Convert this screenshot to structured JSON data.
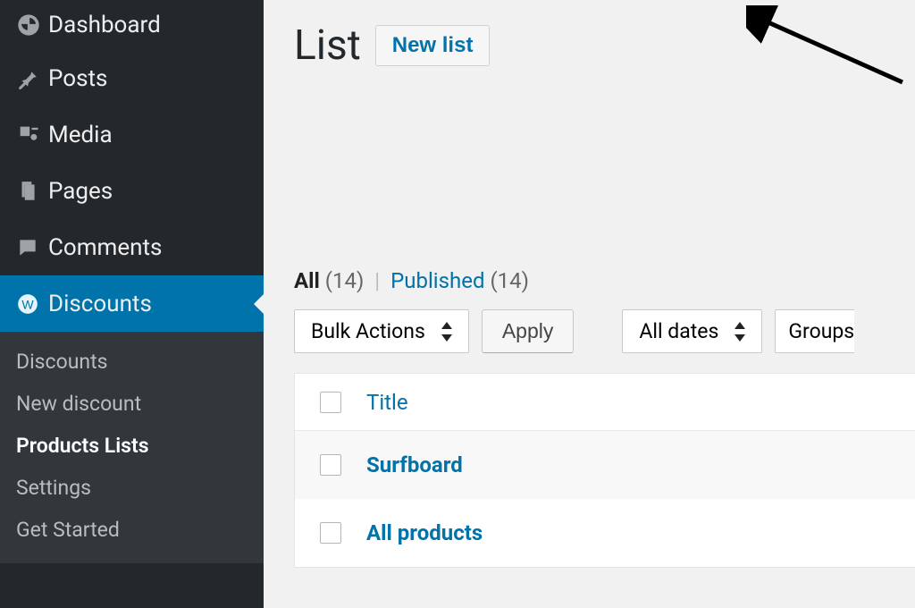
{
  "sidebar": {
    "items": [
      {
        "label": "Dashboard"
      },
      {
        "label": "Posts"
      },
      {
        "label": "Media"
      },
      {
        "label": "Pages"
      },
      {
        "label": "Comments"
      },
      {
        "label": "Discounts"
      }
    ],
    "submenu": {
      "items": [
        {
          "label": "Discounts"
        },
        {
          "label": "New discount"
        },
        {
          "label": "Products Lists"
        },
        {
          "label": "Settings"
        },
        {
          "label": "Get Started"
        }
      ]
    }
  },
  "header": {
    "title": "List",
    "new_list_label": "New list"
  },
  "filters": {
    "all_label": "All",
    "all_count": "(14)",
    "divider": "|",
    "published_label": "Published",
    "published_count": "(14)"
  },
  "controls": {
    "bulk_actions_label": "Bulk Actions",
    "apply_label": "Apply",
    "dates_label": "All dates",
    "groups_label": "Groups"
  },
  "table": {
    "th_title": "Title",
    "rows": [
      {
        "title": "Surfboard"
      },
      {
        "title": "All products"
      }
    ]
  }
}
